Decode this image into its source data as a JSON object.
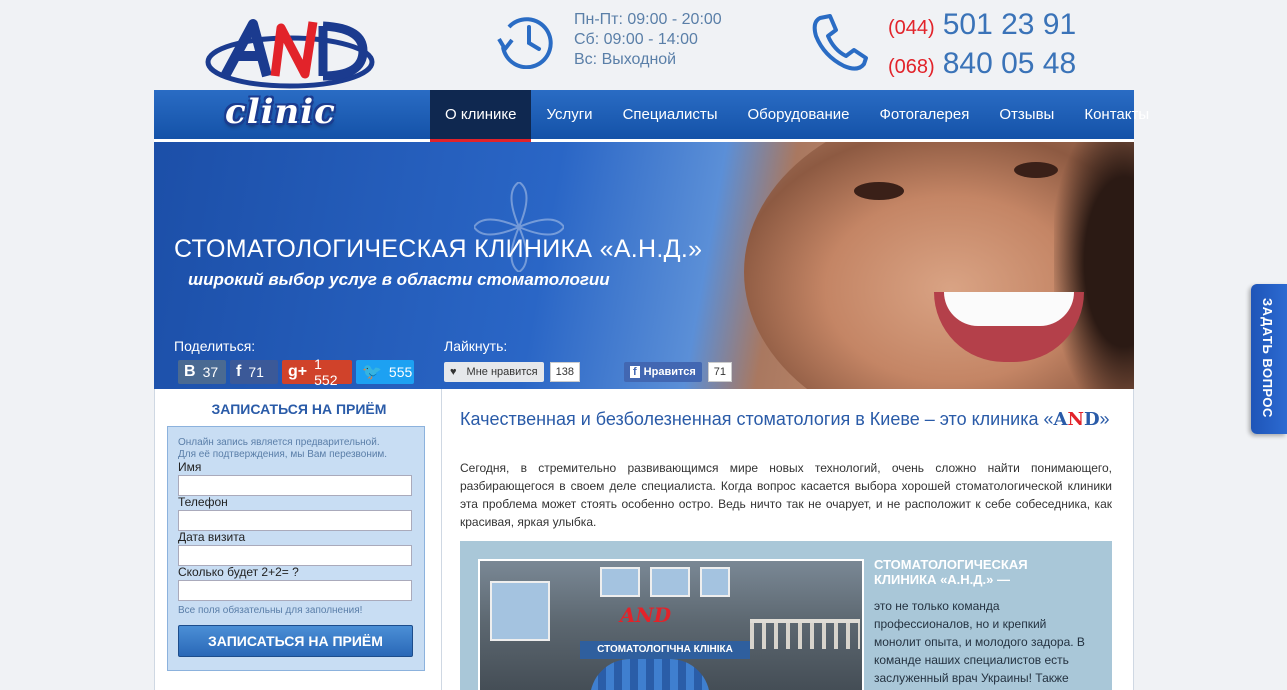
{
  "header": {
    "logo_text": "AND",
    "logo_sub": "clinic",
    "hours": [
      "Пн-Пт: 09:00 - 20:00",
      "Сб: 09:00 - 14:00",
      "Вс: Выходной"
    ],
    "phones": [
      {
        "code": "(044)",
        "number": "501 23 91"
      },
      {
        "code": "(068)",
        "number": "840 05 48"
      }
    ]
  },
  "nav": {
    "items": [
      "О клинике",
      "Услуги",
      "Специалисты",
      "Оборудование",
      "Фотогалерея",
      "Отзывы",
      "Контакты"
    ],
    "active": "О клинике"
  },
  "hero": {
    "title": "СТОМАТОЛОГИЧЕСКАЯ КЛИНИКА «А.Н.Д.»",
    "subtitle": "широкий выбор услуг в области стоматологии",
    "share_label": "Поделиться:",
    "like_label": "Лайкнуть:",
    "share": {
      "vk": "37",
      "fb": "71",
      "gp": "1 552",
      "tw": "555"
    },
    "like": {
      "vk_label": "Мне нравится",
      "vk_count": "138",
      "fb_label": "Нравится",
      "fb_count": "71"
    }
  },
  "sidebar": {
    "title": "ЗАПИСАТЬСЯ НА ПРИЁМ",
    "note_line1": "Онлайн запись является предварительной.",
    "note_line2": "Для её подтверждения, мы Вам перезвоним.",
    "fields": {
      "name": "Имя",
      "phone": "Телефон",
      "date": "Дата визита",
      "captcha": "Сколько будет 2+2= ?"
    },
    "required_note": "Все поля обязательны для заполнения!",
    "submit": "ЗАПИСАТЬСЯ НА ПРИЁМ"
  },
  "main": {
    "heading_prefix": "Качественная и безболезненная стоматология в Киеве – это клиника «",
    "brand_a": "A",
    "brand_n": "N",
    "brand_d": "D",
    "heading_suffix": "»",
    "intro": "Сегодня, в стремительно развивающимся мире новых технологий, очень сложно найти понимающего, разбирающегося в своем деле специалиста. Когда вопрос касается выбора хорошей стоматологической клиники эта проблема может стоять особенно остро. Ведь ничто так не очарует, и не расположит к себе собеседника, как красивая, яркая улыбка.",
    "box_heading": "СТОМАТОЛОГИЧЕСКАЯ КЛИНИКА «А.Н.Д.» —",
    "box_text": "это не только команда профессионалов, но и крепкий монолит опыта, и молодого задора. В команде наших специалистов есть заслуженный врач Украины! Также",
    "photo_sign": "СТОМАТОЛОГІЧНА КЛІНІКА",
    "photo_logo": "AND"
  },
  "ask_tab": "ЗАДАТЬ ВОПРОС"
}
